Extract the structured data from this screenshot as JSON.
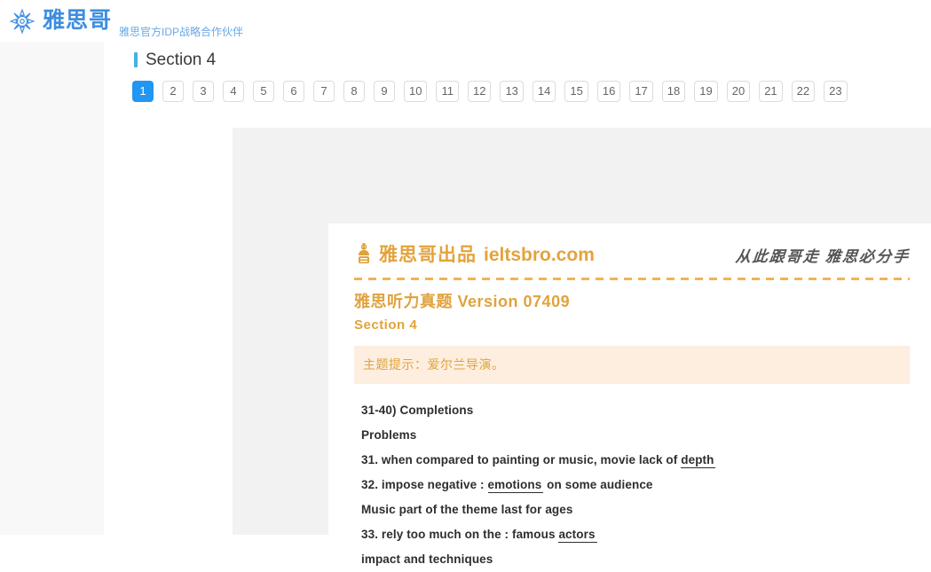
{
  "header": {
    "logo_icon": "ship-wheel-icon",
    "logo_text": "雅思哥",
    "tagline": "雅思官方IDP战略合作伙伴",
    "brand_color": "#3d8ee0"
  },
  "page": {
    "section_title": "Section 4",
    "accent_color": "#40b3e0"
  },
  "pagination": {
    "active": "1",
    "active_color": "#2196f3",
    "items": [
      "1",
      "2",
      "3",
      "4",
      "5",
      "6",
      "7",
      "8",
      "9",
      "10",
      "11",
      "12",
      "13",
      "14",
      "15",
      "16",
      "17",
      "18",
      "19",
      "20",
      "21",
      "22",
      "23"
    ]
  },
  "document": {
    "mascot_icon": "mascot-figure-icon",
    "brand_cn": "雅思哥出品",
    "brand_en": "ieltsbro.com",
    "calligraphy": "从此跟哥走  雅思必分手",
    "brand_color": "#e3a33c",
    "title": "雅思听力真题 Version 07409",
    "subtitle": "Section 4",
    "hint": "主题提示：爱尔兰导演。",
    "hint_bg": "#fdeedf",
    "questions": [
      {
        "text_before": "31-40)  Completions",
        "answer": "",
        "text_after": ""
      },
      {
        "text_before": "Problems",
        "answer": "",
        "text_after": ""
      },
      {
        "text_before": "31. when compared to painting or music, movie lack of ",
        "answer": "depth",
        "text_after": ""
      },
      {
        "text_before": "32. impose negative : ",
        "answer": "emotions",
        "text_after": " on some audience"
      },
      {
        "text_before": "Music part of the theme last for ages",
        "answer": "",
        "text_after": ""
      },
      {
        "text_before": "33. rely too much on the : famous ",
        "answer": "actors",
        "text_after": ""
      },
      {
        "text_before": "impact and techniques",
        "answer": "",
        "text_after": ""
      }
    ]
  }
}
